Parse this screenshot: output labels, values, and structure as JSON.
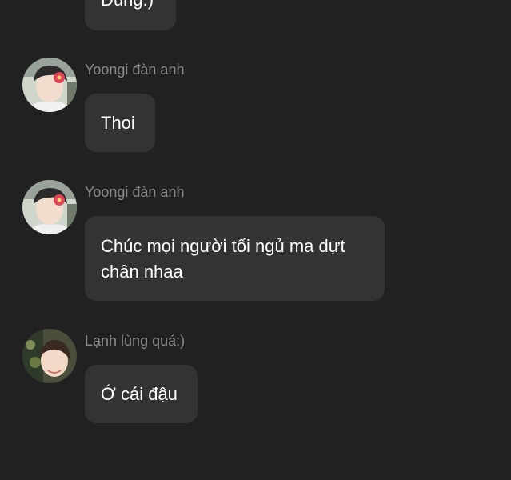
{
  "colors": {
    "background": "#212121",
    "bubble": "#333333",
    "sender_name": "#8a8a8a",
    "message_text": "#ffffff"
  },
  "messages": [
    {
      "sender": "",
      "text": "Dùng:)",
      "avatar_icon": ""
    },
    {
      "sender": "Yoongi đàn anh",
      "text": "Thoi",
      "avatar_icon": "user-avatar-icon"
    },
    {
      "sender": "Yoongi đàn anh",
      "text": "Chúc mọi người tối ngủ ma dựt\nchân nhaa",
      "avatar_icon": "user-avatar-icon"
    },
    {
      "sender": "Lạnh lùng quá:)",
      "text": "Ớ cái đậu",
      "avatar_icon": "user-avatar-icon"
    }
  ]
}
